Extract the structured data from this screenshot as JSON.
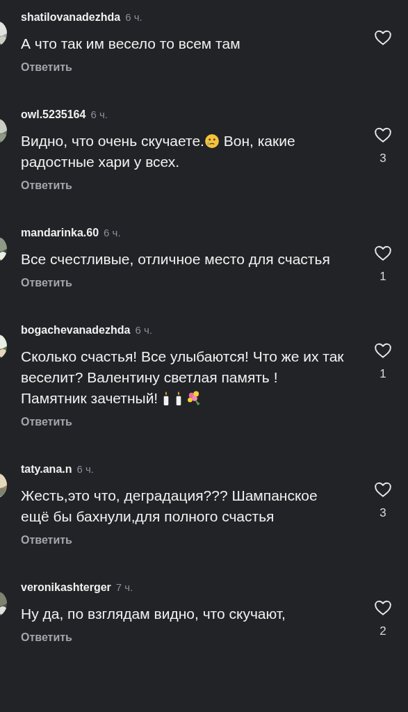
{
  "comments": [
    {
      "username": "shatilovanadezhda",
      "time": "6 ч.",
      "text": [
        {
          "kind": "text",
          "text": "А что так им весело то всем там"
        }
      ],
      "reply": "Ответить",
      "liked": false
    },
    {
      "username": "owl.5235164",
      "time": "6 ч.",
      "text": [
        {
          "kind": "text",
          "text": "Видно, что очень скучаете."
        },
        {
          "kind": "sad-emoji"
        },
        {
          "kind": "text",
          "text": " Вон, какие радостные хари у всех."
        }
      ],
      "reply": "Ответить",
      "liked": false,
      "likes": "3"
    },
    {
      "username": "mandarinka.60",
      "time": "6 ч.",
      "text": [
        {
          "kind": "text",
          "text": "Все счестливые, отличное место для счастья"
        }
      ],
      "reply": "Ответить",
      "liked": false,
      "likes": "1"
    },
    {
      "username": "bogachevanadezhda",
      "time": "6 ч.",
      "text": [
        {
          "kind": "text",
          "text": "Сколько счастья! Все улыбаются! Что же их так веселит? Валентину светлая память ! Памятник зачетный! "
        },
        {
          "kind": "candle"
        },
        {
          "kind": "candle"
        },
        {
          "kind": "bouquet"
        }
      ],
      "reply": "Ответить",
      "liked": false,
      "likes": "1"
    },
    {
      "username": "taty.ana.n",
      "time": "6 ч.",
      "text": [
        {
          "kind": "text",
          "text": "Жесть,это что, деградация??? Шампанское ещё бы бахнули,для полного счастья"
        }
      ],
      "reply": "Ответить",
      "liked": false,
      "likes": "3"
    },
    {
      "username": "veronikashterger",
      "time": "7 ч.",
      "text": [
        {
          "kind": "text",
          "text": "Ну да, по взглядам видно, что скучают,"
        }
      ],
      "reply": "Ответить",
      "liked": false,
      "likes": "2"
    }
  ]
}
